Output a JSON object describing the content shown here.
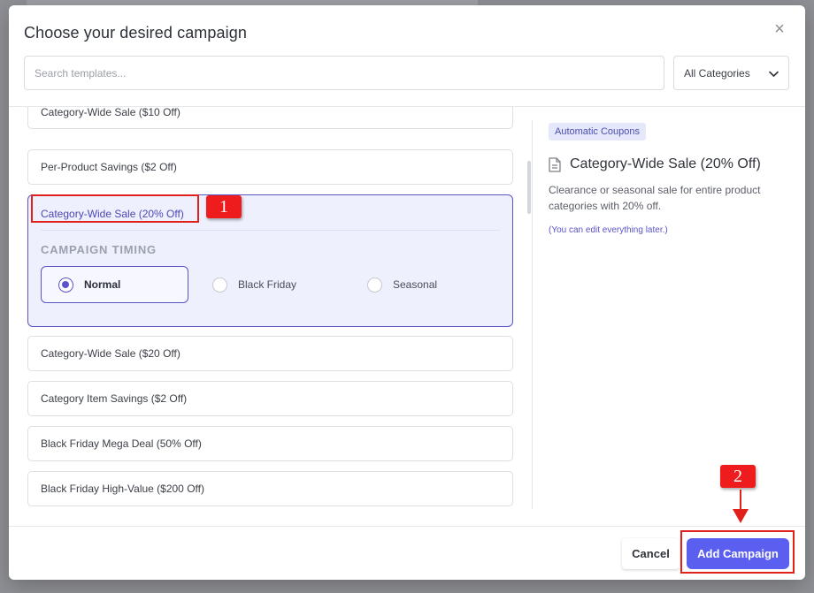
{
  "modal": {
    "title": "Choose your desired campaign",
    "close_symbol": "×"
  },
  "search": {
    "placeholder": "Search templates..."
  },
  "category_select": {
    "selected": "All Categories"
  },
  "templates": {
    "partial_top": "Category-Wide Sale ($10 Off)",
    "items_above": [
      "Per-Product Savings ($2 Off)"
    ],
    "selected": {
      "label": "Category-Wide Sale (20% Off)",
      "timing_label": "CAMPAIGN TIMING",
      "timing_options": [
        {
          "label": "Normal",
          "selected": true
        },
        {
          "label": "Black Friday",
          "selected": false
        },
        {
          "label": "Seasonal",
          "selected": false
        }
      ]
    },
    "items_below": [
      "Category-Wide Sale ($20 Off)",
      "Category Item Savings ($2 Off)",
      "Black Friday Mega Deal (50% Off)",
      "Black Friday High-Value ($200 Off)"
    ]
  },
  "preview": {
    "tag": "Automatic Coupons",
    "icon": "document-icon",
    "title": "Category-Wide Sale (20% Off)",
    "description": "Clearance or seasonal sale for entire product categories with 20% off.",
    "note": "(You can edit everything later.)"
  },
  "footer": {
    "cancel_label": "Cancel",
    "add_label": "Add Campaign"
  },
  "annotations": {
    "step1": "1",
    "step2": "2"
  },
  "colors": {
    "accent": "#5a55c7",
    "primary_button": "#5b5ff0",
    "annotation_red": "#e0201b"
  }
}
